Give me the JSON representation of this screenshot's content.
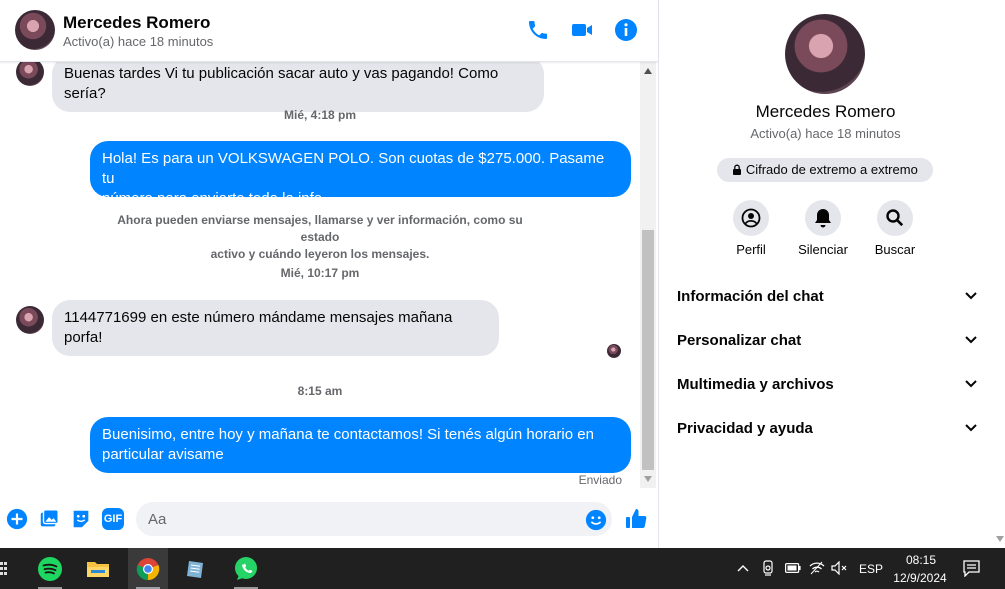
{
  "header": {
    "name": "Mercedes Romero",
    "status": "Activo(a) hace 18 minutos",
    "icons": [
      "phone-icon",
      "video-icon",
      "info-icon"
    ]
  },
  "messages": {
    "m1": "Buenas tardes Vi tu publicación sacar auto y vas pagando! Como sería?",
    "t1": "Mié, 4:18 pm",
    "m2_line1": "Hola! Es para un VOLKSWAGEN POLO. Son cuotas de $275.000. Pasame tu",
    "m2_line2": "número para enviarte toda la info",
    "system_line1": "Ahora pueden enviarse mensajes, llamarse y ver información, como su estado",
    "system_line2": "activo y cuándo leyeron los mensajes.",
    "t2": "Mié, 10:17 pm",
    "m3": "1144771699 en este número mándame mensajes mañana porfa!",
    "t3": "8:15 am",
    "m4_line1": "Buenisimo, entre hoy y mañana te contactamos! Si tenés algún horario en",
    "m4_line2": "particular avisame",
    "sent_status": "Enviado"
  },
  "composer": {
    "placeholder": "Aa",
    "icons": [
      "plus-icon",
      "photo-icon",
      "sticker-icon",
      "gif-icon",
      "emoji-icon",
      "like-icon"
    ],
    "gif_label": "GIF"
  },
  "info_panel": {
    "name": "Mercedes Romero",
    "status": "Activo(a) hace 18 minutos",
    "encryption": "Cifrado de extremo a extremo",
    "actions": [
      {
        "label": "Perfil",
        "icon": "profile-icon"
      },
      {
        "label": "Silenciar",
        "icon": "bell-icon"
      },
      {
        "label": "Buscar",
        "icon": "search-icon"
      }
    ],
    "sections": [
      {
        "label": "Información del chat"
      },
      {
        "label": "Personalizar chat"
      },
      {
        "label": "Multimedia y archivos"
      },
      {
        "label": "Privacidad y ayuda"
      }
    ]
  },
  "taskbar": {
    "apps": [
      "spotify-icon",
      "file-explorer-icon",
      "chrome-icon",
      "notepad-icon",
      "whatsapp-icon"
    ],
    "language": "ESP",
    "time": "08:15",
    "date": "12/9/2024"
  },
  "colors": {
    "accent": "#0084ff",
    "bubble_in": "#e4e6eb",
    "text_secondary": "#65676b",
    "taskbar": "#202020"
  }
}
